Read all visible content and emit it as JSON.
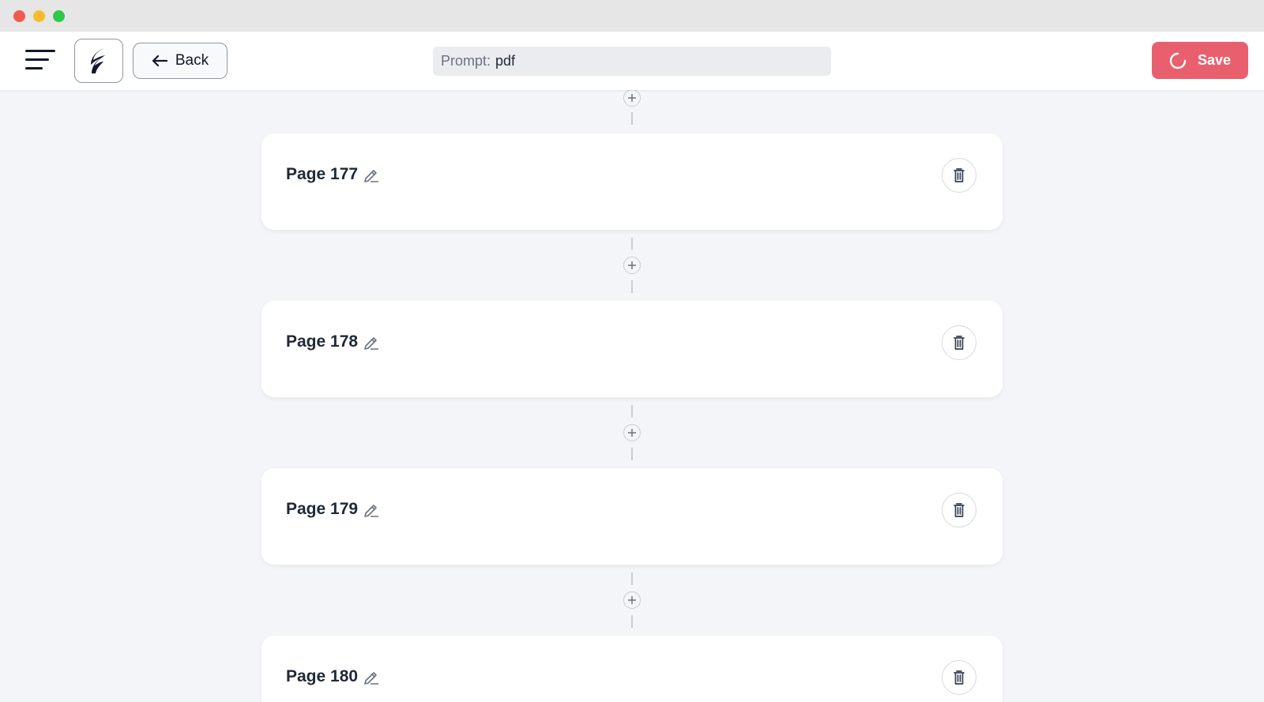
{
  "header": {
    "back_label": "Back",
    "prompt_label": "Prompt:",
    "prompt_value": "pdf",
    "save_label": "Save"
  },
  "pages": [
    {
      "title": "Page 177"
    },
    {
      "title": "Page 178"
    },
    {
      "title": "Page 179"
    },
    {
      "title": "Page 180"
    }
  ],
  "colors": {
    "save_button": "#e8606e",
    "background": "#f4f5f8",
    "card": "#ffffff"
  },
  "icons": {
    "menu": "hamburger-icon",
    "logo": "app-logo-icon",
    "back": "arrow-left-icon",
    "save_spinner": "spinner-icon",
    "add": "plus-icon",
    "edit": "pencil-icon",
    "delete": "trash-icon"
  }
}
